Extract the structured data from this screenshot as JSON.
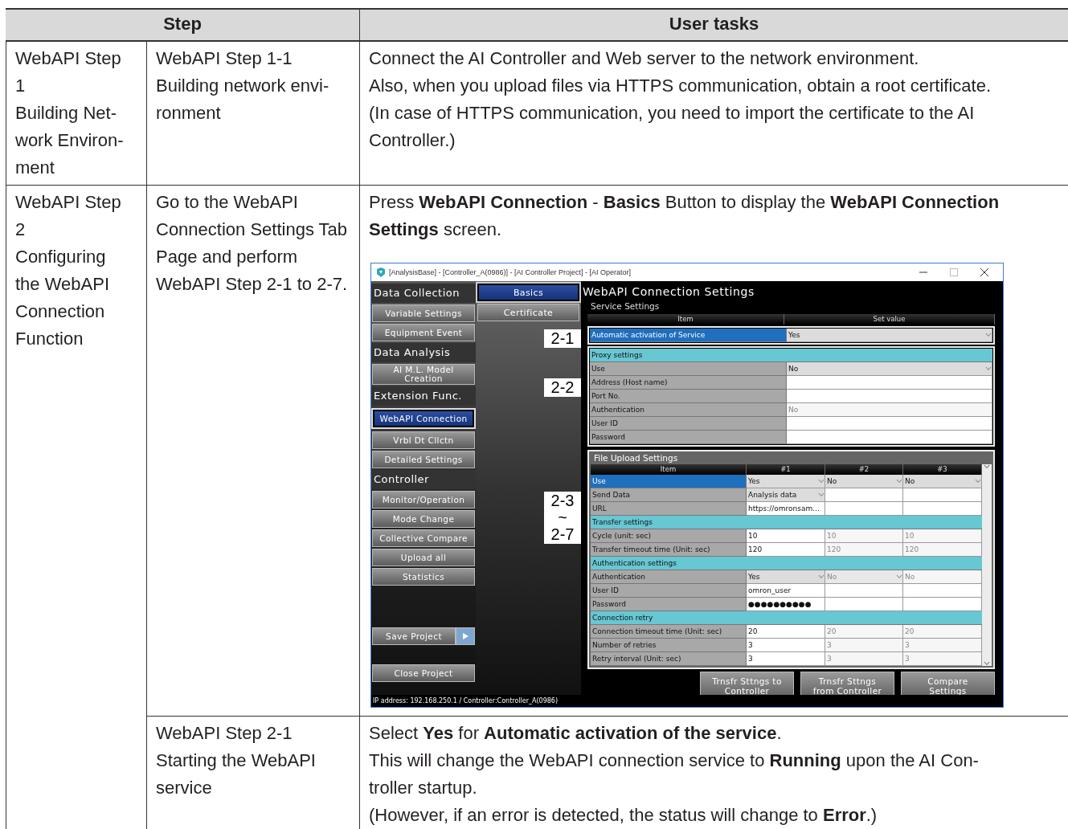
{
  "table": {
    "columns": [
      "Step",
      "User tasks"
    ],
    "groups": [
      {
        "step": "WebAPI Step\n1\nBuilding Net-\nwork Environ-\nment",
        "rows": [
          {
            "substep": "WebAPI Step 1-1\nBuilding network envi-\nronment",
            "tasks": [
              "Connect the AI Controller and Web server to the network environment.",
              "Also, when you upload files via HTTPS communication, obtain a root certificate.",
              "(In case of HTTPS communication, you need to import the certificate to the AI Controller.)"
            ]
          }
        ]
      },
      {
        "step": "WebAPI Step\n2\nConfiguring\nthe WebAPI\nConnection\nFunction",
        "rows": [
          {
            "substep": "Go to the WebAPI Connection Settings Tab Page and perform WebAPI Step 2-1 to 2-7.",
            "tasks": [
              "Press **WebAPI Connection** - **Basics** Button to display the **WebAPI Connection Settings** screen."
            ],
            "screenshot": true
          },
          {
            "substep": "WebAPI Step 2-1\nStarting the WebAPI service",
            "tasks": [
              "Select **Yes** for **Automatic activation of the service**.",
              "This will change the WebAPI connection service to **Running** upon the AI Con-\ntroller startup.",
              "(However, if an error is detected, the status will change to **Error**.)"
            ]
          }
        ]
      }
    ]
  },
  "screenshot": {
    "title": "[AnalysisBase] - [Controller_A(0986)] - [AI Controller Project] - [AI Operator]",
    "sidebar": [
      {
        "kind": "heading",
        "label": "Data Collection"
      },
      {
        "kind": "button",
        "label": "Variable Settings",
        "selected": false
      },
      {
        "kind": "button",
        "label": "Equipment Event",
        "selected": false
      },
      {
        "kind": "heading",
        "label": "Data Analysis"
      },
      {
        "kind": "button",
        "label": "AI M.L. Model\nCreation",
        "selected": false
      },
      {
        "kind": "heading",
        "label": "Extension Func."
      },
      {
        "kind": "button",
        "label": "WebAPI Connection",
        "selected": true
      },
      {
        "kind": "button",
        "label": "Vrbl Dt Cllctn",
        "selected": false
      },
      {
        "kind": "button",
        "label": "Detailed Settings",
        "selected": false
      },
      {
        "kind": "heading",
        "label": "Controller"
      },
      {
        "kind": "button",
        "label": "Monitor/Operation",
        "selected": false
      },
      {
        "kind": "button",
        "label": "Mode Change",
        "selected": false
      },
      {
        "kind": "button",
        "label": "Collective Compare",
        "selected": false
      },
      {
        "kind": "button",
        "label": "Upload all",
        "selected": false
      },
      {
        "kind": "button",
        "label": "Statistics",
        "selected": false
      }
    ],
    "save_button": "Save Project",
    "close_button": "Close Project",
    "tabs": [
      {
        "label": "Basics",
        "selected": true
      },
      {
        "label": "Certificate",
        "selected": false
      }
    ],
    "callouts": [
      "2-1",
      "2-2",
      "2-3\n~\n2-7"
    ],
    "heading": "WebAPI Connection Settings",
    "service_settings": {
      "title": "Service Settings",
      "columns": [
        "Item",
        "Set value"
      ],
      "rows": [
        {
          "kind": "setting",
          "label": "Automatic activation of Service",
          "selected": true,
          "cells": [
            {
              "value": "Yes",
              "dropdown": true,
              "disabled": false
            }
          ]
        },
        {
          "kind": "group",
          "label": "Proxy settings"
        },
        {
          "kind": "setting",
          "label": "Use",
          "selected": false,
          "cells": [
            {
              "value": "No",
              "dropdown": true,
              "disabled": false
            }
          ]
        },
        {
          "kind": "setting",
          "label": "Address (Host name)",
          "selected": false,
          "cells": [
            {
              "dropdown": false
            }
          ]
        },
        {
          "kind": "setting",
          "label": "Port No.",
          "selected": false,
          "cells": [
            {
              "dropdown": false
            }
          ]
        },
        {
          "kind": "setting",
          "label": "Authentication",
          "selected": false,
          "cells": [
            {
              "value": "No",
              "dropdown": false,
              "disabled": true
            }
          ]
        },
        {
          "kind": "setting",
          "label": "User ID",
          "selected": false,
          "cells": [
            {
              "dropdown": false
            }
          ]
        },
        {
          "kind": "setting",
          "label": "Password",
          "selected": false,
          "cells": [
            {
              "dropdown": false
            }
          ]
        }
      ]
    },
    "upload_settings": {
      "title": "File Upload Settings",
      "columns": [
        "Item",
        "#1",
        "#2",
        "#3"
      ],
      "rows": [
        {
          "kind": "setting",
          "label": "Use",
          "selected": true,
          "cells": [
            {
              "value": "Yes",
              "dropdown": true,
              "disabled": false
            },
            {
              "value": "No",
              "dropdown": true,
              "disabled": false
            },
            {
              "value": "No",
              "dropdown": true,
              "disabled": false
            }
          ]
        },
        {
          "kind": "setting",
          "label": "Send Data",
          "selected": false,
          "cells": [
            {
              "value": "Analysis data",
              "dropdown": true,
              "disabled": false
            },
            {
              "dropdown": false
            },
            {
              "dropdown": false
            }
          ]
        },
        {
          "kind": "setting",
          "label": "URL",
          "selected": false,
          "cells": [
            {
              "value": "https://omronsam...",
              "dropdown": false,
              "disabled": false
            },
            {
              "dropdown": false
            },
            {
              "dropdown": false
            }
          ]
        },
        {
          "kind": "group",
          "label": "Transfer settings"
        },
        {
          "kind": "setting",
          "label": "Cycle (unit: sec)",
          "selected": false,
          "cells": [
            {
              "value": "10",
              "dropdown": false,
              "disabled": false
            },
            {
              "value": "10",
              "dropdown": false,
              "disabled": true
            },
            {
              "value": "10",
              "dropdown": false,
              "disabled": true
            }
          ]
        },
        {
          "kind": "setting",
          "label": "Transfer timeout time (Unit: sec)",
          "selected": false,
          "cells": [
            {
              "value": "120",
              "dropdown": false,
              "disabled": false
            },
            {
              "value": "120",
              "dropdown": false,
              "disabled": true
            },
            {
              "value": "120",
              "dropdown": false,
              "disabled": true
            }
          ]
        },
        {
          "kind": "group",
          "label": "Authentication settings"
        },
        {
          "kind": "setting",
          "label": "Authentication",
          "selected": false,
          "cells": [
            {
              "value": "Yes",
              "dropdown": true,
              "disabled": false
            },
            {
              "value": "No",
              "dropdown": true,
              "disabled": true
            },
            {
              "value": "No",
              "dropdown": false,
              "disabled": true
            }
          ]
        },
        {
          "kind": "setting",
          "label": "User ID",
          "selected": false,
          "cells": [
            {
              "value": "omron_user",
              "dropdown": false,
              "disabled": false
            },
            {
              "dropdown": false
            },
            {
              "dropdown": false
            }
          ]
        },
        {
          "kind": "setting",
          "label": "Password",
          "selected": false,
          "cells": [
            {
              "value": "●●●●●●●●●●",
              "dropdown": false,
              "disabled": false
            },
            {
              "dropdown": false
            },
            {
              "dropdown": false
            }
          ]
        },
        {
          "kind": "group",
          "label": "Connection retry"
        },
        {
          "kind": "setting",
          "label": "Connection timeout time (Unit: sec)",
          "selected": false,
          "cells": [
            {
              "value": "20",
              "dropdown": false,
              "disabled": false
            },
            {
              "value": "20",
              "dropdown": false,
              "disabled": true
            },
            {
              "value": "20",
              "dropdown": false,
              "disabled": true
            }
          ]
        },
        {
          "kind": "setting",
          "label": "Number of retries",
          "selected": false,
          "cells": [
            {
              "value": "3",
              "dropdown": false,
              "disabled": false
            },
            {
              "value": "3",
              "dropdown": false,
              "disabled": true
            },
            {
              "value": "3",
              "dropdown": false,
              "disabled": true
            }
          ]
        },
        {
          "kind": "setting",
          "label": "Retry interval (Unit: sec)",
          "selected": false,
          "cells": [
            {
              "value": "3",
              "dropdown": false,
              "disabled": false
            },
            {
              "value": "3",
              "dropdown": false,
              "disabled": true
            },
            {
              "value": "3",
              "dropdown": false,
              "disabled": true
            }
          ]
        }
      ]
    },
    "action_buttons": [
      "Trnsfr Sttngs to\nController",
      "Trnsfr Sttngs\nfrom Controller",
      "Compare\nSettings"
    ],
    "status_bar": "IP address: 192.168.250.1 / Controller:Controller_A(0986)"
  }
}
